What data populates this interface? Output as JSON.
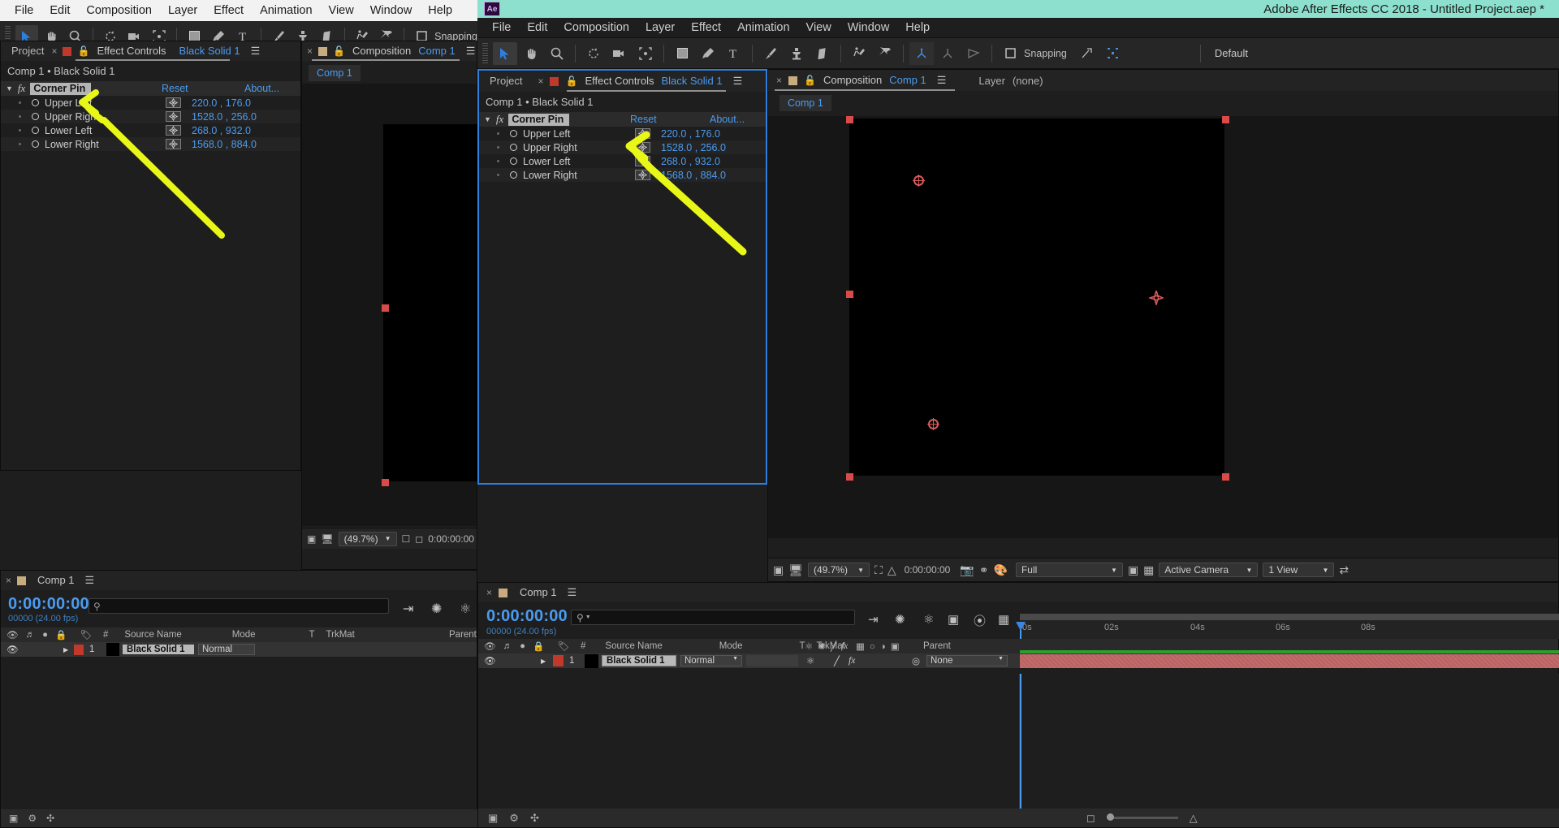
{
  "app": {
    "title": "Adobe After Effects CC 2018 - Untitled Project.aep *",
    "titlebar_color": "#8ce0cd",
    "logo": "Ae",
    "accent_blue": "#4b9bf0",
    "highlight_yellow": "#e8f718",
    "pin_red": "#d94a4a"
  },
  "menu": {
    "items": [
      "File",
      "Edit",
      "Composition",
      "Layer",
      "Effect",
      "Animation",
      "View",
      "Window",
      "Help"
    ]
  },
  "toolbar": {
    "tools": [
      {
        "name": "selection-tool",
        "glyph": "arrow"
      },
      {
        "name": "hand-tool",
        "glyph": "hand"
      },
      {
        "name": "zoom-tool",
        "glyph": "magnifier"
      },
      {
        "name": "rotation-tool",
        "glyph": "rotate"
      },
      {
        "name": "camera-tool",
        "glyph": "camera"
      },
      {
        "name": "pan-behind-tool",
        "glyph": "anchor-region"
      },
      {
        "name": "shape-tool",
        "glyph": "square"
      },
      {
        "name": "pen-tool",
        "glyph": "pen"
      },
      {
        "name": "type-tool",
        "glyph": "T"
      },
      {
        "name": "brush-tool",
        "glyph": "brush"
      },
      {
        "name": "clone-stamp-tool",
        "glyph": "stamp"
      },
      {
        "name": "eraser-tool",
        "glyph": "eraser"
      },
      {
        "name": "roto-brush-tool",
        "glyph": "roto"
      },
      {
        "name": "puppet-pin-tool",
        "glyph": "pin"
      }
    ],
    "snapping_label": "Snapping",
    "workspace_label": "Default"
  },
  "effect_controls": {
    "tabs": {
      "project": "Project",
      "effect_controls": "Effect Controls",
      "effect_controls_target": "Black Solid 1"
    },
    "breadcrumb": "Comp 1 • Black Solid 1",
    "effect_name": "Corner Pin",
    "reset_label": "Reset",
    "about_label": "About...",
    "properties": [
      {
        "label": "Upper Left",
        "value": "220.0 , 176.0"
      },
      {
        "label": "Upper Right",
        "value": "1528.0 , 256.0"
      },
      {
        "label": "Lower Left",
        "value": "268.0 , 932.0"
      },
      {
        "label": "Lower Right",
        "value": "1568.0 , 884.0"
      }
    ]
  },
  "composition": {
    "tabs": {
      "composition": "Composition",
      "comp_name": "Comp 1",
      "layer_label": "Layer",
      "layer_value": "(none)"
    },
    "comp_tab": "Comp 1",
    "viewer_bar": {
      "zoom": "(49.7%)",
      "timecode": "0:00:00:00",
      "resolution": "Full",
      "view": "Active Camera",
      "view_layout": "1 View"
    }
  },
  "timeline": {
    "tab_name": "Comp 1",
    "current_time": "0:00:00:00",
    "frame_info": "00000 (24.00 fps)",
    "columns": [
      "#",
      "Source Name",
      "Mode",
      "T",
      "TrkMat",
      "Parent"
    ],
    "layer": {
      "index": "1",
      "source_name": "Black Solid 1",
      "mode": "Normal",
      "trkmat": "",
      "parent": "None"
    },
    "ruler_ticks": [
      "0s",
      "02s",
      "04s",
      "06s",
      "08s"
    ]
  },
  "annotation": {
    "kind": "hand-drawn-arrow",
    "color": "#e8f718",
    "points_to": "Corner Pin"
  }
}
